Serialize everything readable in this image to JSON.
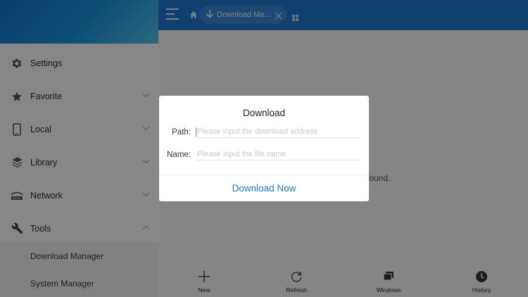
{
  "sidebar": {
    "items": [
      {
        "label": "Settings",
        "icon": "gear-icon"
      },
      {
        "label": "Favorite",
        "icon": "star-icon",
        "chevron": "down"
      },
      {
        "label": "Local",
        "icon": "phone-icon",
        "chevron": "down"
      },
      {
        "label": "Library",
        "icon": "layers-icon",
        "chevron": "down"
      },
      {
        "label": "Network",
        "icon": "network-icon",
        "chevron": "down"
      },
      {
        "label": "Tools",
        "icon": "wrench-icon",
        "chevron": "up"
      }
    ],
    "subitems": [
      {
        "label": "Download Manager"
      },
      {
        "label": "System Manager"
      }
    ]
  },
  "topbar": {
    "tab_label": "Download Ma...",
    "colors": {
      "bar": "#1f73cc",
      "tab": "#3a86d6"
    }
  },
  "main": {
    "empty_text": "found."
  },
  "bottombar": {
    "tools": [
      {
        "label": "New",
        "icon": "plus-icon"
      },
      {
        "label": "Refresh",
        "icon": "refresh-icon"
      },
      {
        "label": "Windows",
        "icon": "windows-icon"
      },
      {
        "label": "History",
        "icon": "clock-icon"
      }
    ]
  },
  "dialog": {
    "title": "Download",
    "path_label": "Path:",
    "path_placeholder": "Please input the download address",
    "path_value": "",
    "name_label": "Name:",
    "name_placeholder": "Please input the file name",
    "name_value": "",
    "button_label": "Download Now",
    "accent": "#2277cc"
  }
}
